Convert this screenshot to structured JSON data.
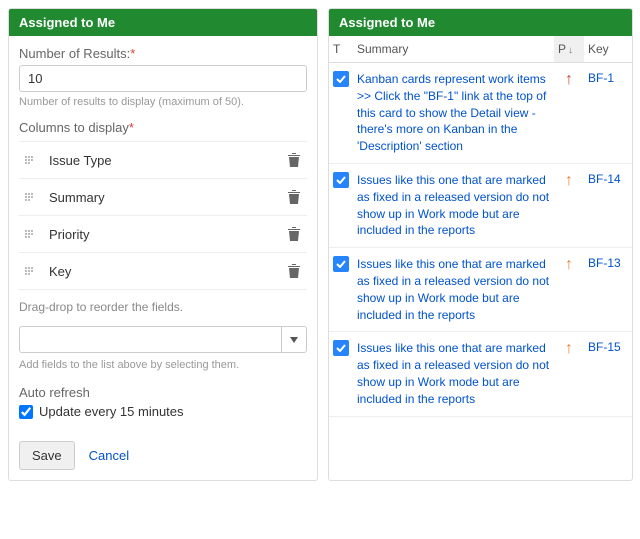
{
  "leftPanel": {
    "title": "Assigned to Me",
    "numResultsLabel": "Number of Results:",
    "numResultsValue": "10",
    "numResultsHint": "Number of results to display (maximum of 50).",
    "columnsLabel": "Columns to display",
    "fields": [
      {
        "label": "Issue Type"
      },
      {
        "label": "Summary"
      },
      {
        "label": "Priority"
      },
      {
        "label": "Key"
      }
    ],
    "reorderHint": "Drag-drop to reorder the fields.",
    "addFieldsHint": "Add fields to the list above by selecting them.",
    "autoRefreshHead": "Auto refresh",
    "autoRefreshLabel": "Update every 15 minutes",
    "saveLabel": "Save",
    "cancelLabel": "Cancel"
  },
  "rightPanel": {
    "title": "Assigned to Me",
    "headers": {
      "t": "T",
      "summary": "Summary",
      "p": "P",
      "key": "Key"
    },
    "rows": [
      {
        "summary": "Kanban cards represent work items >> Click the \"BF-1\" link at the top of this card to show the Detail view - there's more on Kanban in the 'Description' section",
        "priorityColor": "arrow-red",
        "key": "BF-1"
      },
      {
        "summary": "Issues like this one that are marked as fixed in a released version do not show up in Work mode but are included in the reports",
        "priorityColor": "arrow-orange",
        "key": "BF-14"
      },
      {
        "summary": "Issues like this one that are marked as fixed in a released version do not show up in Work mode but are included in the reports",
        "priorityColor": "arrow-orange",
        "key": "BF-13"
      },
      {
        "summary": "Issues like this one that are marked as fixed in a released version do not show up in Work mode but are included in the reports",
        "priorityColor": "arrow-orange",
        "key": "BF-15"
      }
    ]
  }
}
